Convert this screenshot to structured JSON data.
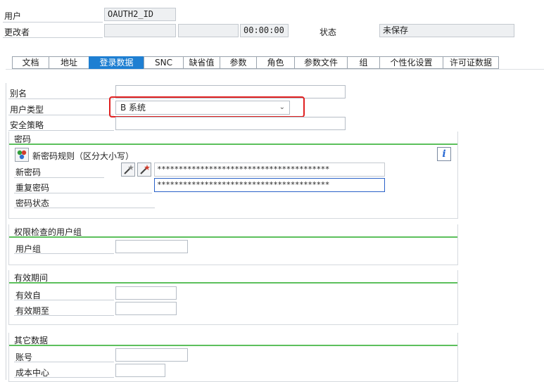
{
  "header": {
    "user_label": "用户",
    "user_value": "OAUTH2_ID",
    "changed_by_label": "更改者",
    "changed_time": "00:00:00",
    "status_label": "状态",
    "status_value": "未保存"
  },
  "tabs": [
    {
      "label": "文档"
    },
    {
      "label": "地址"
    },
    {
      "label": "登录数据"
    },
    {
      "label": "SNC"
    },
    {
      "label": "缺省值"
    },
    {
      "label": "参数"
    },
    {
      "label": "角色"
    },
    {
      "label": "参数文件"
    },
    {
      "label": "组"
    },
    {
      "label": "个性化设置"
    },
    {
      "label": "许可证数据"
    }
  ],
  "active_tab": "登录数据",
  "top_fields": {
    "alias_label": "别名",
    "alias_value": "",
    "user_type_label": "用户类型",
    "user_type_value": "B 系统",
    "security_policy_label": "安全策略",
    "security_policy_value": ""
  },
  "password_group": {
    "title": "密码",
    "rules_text": "新密码规则（区分大小写）",
    "new_password_label": "新密码",
    "new_password_value": "****************************************",
    "repeat_password_label": "重复密码",
    "repeat_password_value": "****************************************",
    "password_status_label": "密码状态"
  },
  "auth_group": {
    "title": "权限检查的用户组",
    "user_group_label": "用户组",
    "user_group_value": ""
  },
  "validity_group": {
    "title": "有效期间",
    "valid_from_label": "有效自",
    "valid_to_label": "有效期至"
  },
  "other_group": {
    "title": "其它数据",
    "account_label": "账号",
    "cost_center_label": "成本中心"
  },
  "colors": {
    "active_tab": "#1e7fd2",
    "group_line": "#5cc05c",
    "highlight": "#e02020"
  }
}
